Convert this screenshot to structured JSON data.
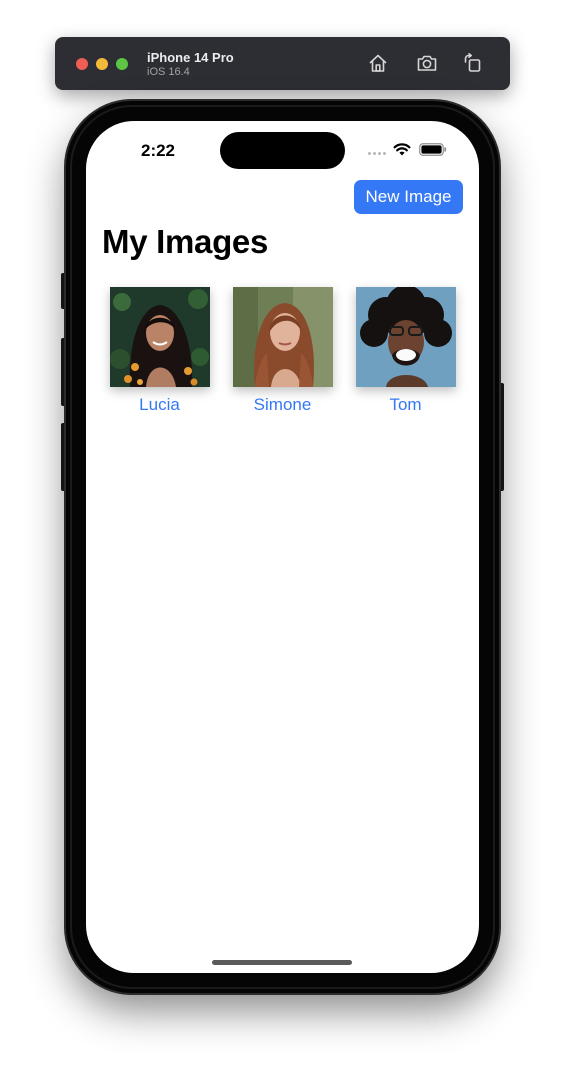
{
  "simulator": {
    "device_name": "iPhone 14 Pro",
    "os_version": "iOS 16.4",
    "toolbar_icons": [
      "home-icon",
      "screenshot-camera-icon",
      "rotate-icon"
    ],
    "traffic_light_colors": [
      "#ee5e55",
      "#f2b93b",
      "#5ec544"
    ]
  },
  "status_bar": {
    "time": "2:22",
    "icons": [
      "cellular-signal-icon",
      "wifi-icon",
      "battery-icon"
    ]
  },
  "app": {
    "new_image_button": "New Image",
    "title": "My Images",
    "accent_color": "#3478f6",
    "images": [
      {
        "label": "Lucia",
        "icon": "portrait-photo"
      },
      {
        "label": "Simone",
        "icon": "portrait-photo"
      },
      {
        "label": "Tom",
        "icon": "portrait-photo"
      }
    ]
  }
}
